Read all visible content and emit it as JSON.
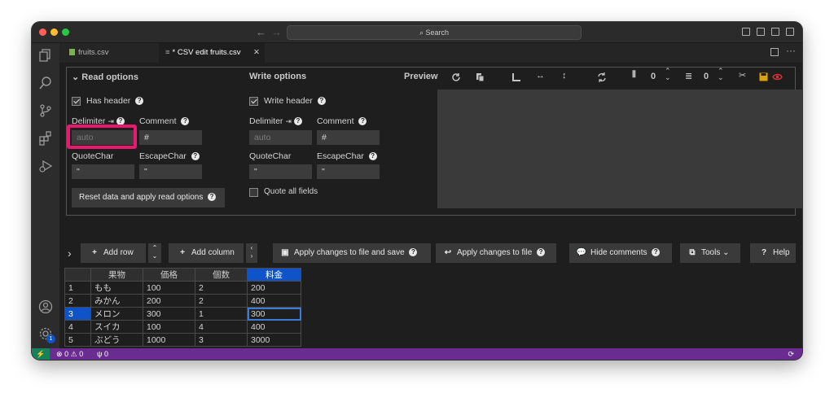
{
  "window": {
    "search_label": "Search",
    "nav_back": "←",
    "nav_forward": "→"
  },
  "tabs": [
    {
      "label": "fruits.csv",
      "active": false
    },
    {
      "label": "* CSV edit fruits.csv",
      "active": true,
      "close": "✕"
    }
  ],
  "read_options": {
    "title": "Read options",
    "has_header_label": "Has header",
    "delimiter_label": "Delimiter",
    "delimiter_tab_glyph": "⇥",
    "delimiter_placeholder": "auto",
    "comment_label": "Comment",
    "comment_value": "#",
    "quotechar_label": "QuoteChar",
    "quotechar_value": "\"",
    "escapechar_label": "EscapeChar",
    "escapechar_value": "\"",
    "reset_button": "Reset data and apply read options"
  },
  "write_options": {
    "title": "Write options",
    "write_header_label": "Write header",
    "delimiter_label": "Delimiter",
    "delimiter_tab_glyph": "⇥",
    "delimiter_placeholder": "auto",
    "comment_label": "Comment",
    "comment_value": "#",
    "quotechar_label": "QuoteChar",
    "quotechar_value": "\"",
    "escapechar_label": "EscapeChar",
    "escapechar_value": "\"",
    "quote_all_label": "Quote all fields"
  },
  "preview": {
    "title": "Preview",
    "columns_count": "0",
    "rows_count": "0"
  },
  "toolbar": {
    "expand": "›",
    "add_row": "Add row",
    "add_column": "Add column",
    "apply_save": "Apply changes to file and save",
    "apply": "Apply changes to file",
    "hide_comments": "Hide comments",
    "tools": "Tools",
    "help": "Help",
    "help_glyph": "?"
  },
  "table": {
    "headers": [
      "",
      "果物",
      "価格",
      "個数",
      "料金"
    ],
    "rows": [
      [
        "1",
        "もも",
        "100",
        "2",
        "200"
      ],
      [
        "2",
        "みかん",
        "200",
        "2",
        "400"
      ],
      [
        "3",
        "メロン",
        "300",
        "1",
        "300"
      ],
      [
        "4",
        "スイカ",
        "100",
        "4",
        "400"
      ],
      [
        "5",
        "ぶどう",
        "1000",
        "3",
        "3000"
      ]
    ]
  },
  "status": {
    "errors": "0",
    "warnings": "0",
    "ports": "0",
    "notification_count": "1"
  },
  "colors": {
    "accent": "#0e54c8",
    "status_bar": "#6a2c91",
    "remote_indicator": "#16825d",
    "highlight_box": "#e8196e"
  }
}
